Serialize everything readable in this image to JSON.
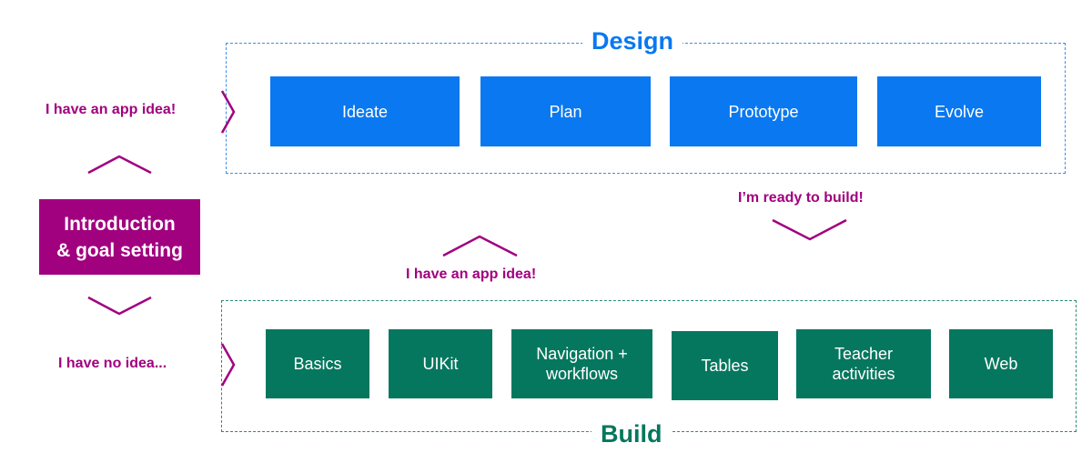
{
  "colors": {
    "design_blue": "#0a78f0",
    "build_green": "#05775e",
    "accent_magenta": "#a1007f"
  },
  "intro": {
    "line1": "Introduction",
    "line2": "& goal setting"
  },
  "design": {
    "title": "Design",
    "steps": [
      {
        "label": "Ideate"
      },
      {
        "label": "Plan"
      },
      {
        "label": "Prototype"
      },
      {
        "label": "Evolve"
      }
    ]
  },
  "build": {
    "title": "Build",
    "steps": [
      {
        "line1": "Basics",
        "line2": ""
      },
      {
        "line1": "UIKit",
        "line2": ""
      },
      {
        "line1": "Navigation +",
        "line2": "workflows"
      },
      {
        "line1": "Tables",
        "line2": ""
      },
      {
        "line1": "Teacher",
        "line2": "activities"
      },
      {
        "line1": "Web",
        "line2": ""
      }
    ]
  },
  "paths": {
    "to_design": "I have an app idea!",
    "to_build": "I have no idea...",
    "build_to_design": "I have an app idea!",
    "design_to_build": "I’m ready to build!"
  }
}
